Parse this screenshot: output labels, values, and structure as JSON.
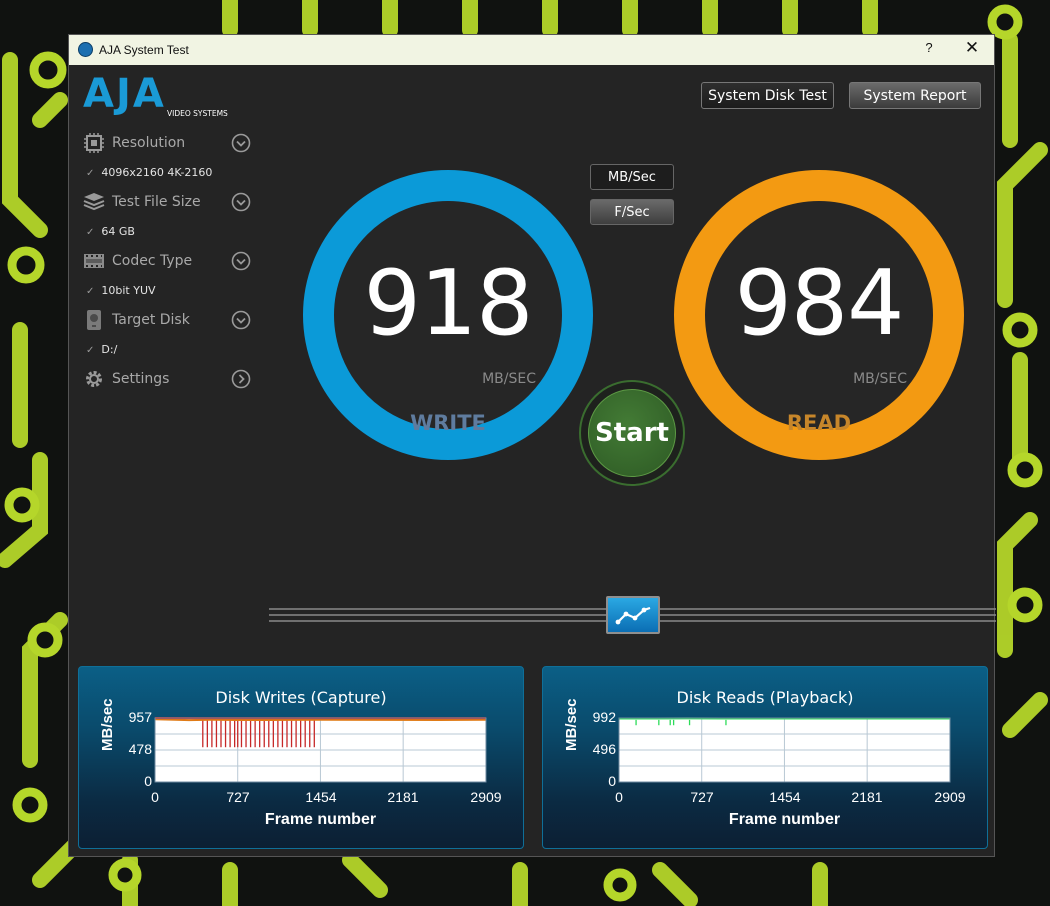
{
  "window": {
    "title": "AJA System Test",
    "help": "?",
    "close": "✕"
  },
  "logo": {
    "main": "AJA",
    "sub": "VIDEO SYSTEMS"
  },
  "toolbar": {
    "system_disk_test": "System Disk Test",
    "system_report": "System Report"
  },
  "sidebar": [
    {
      "label": "Resolution",
      "value": "4096x2160 4K-2160",
      "icon": "chip-icon"
    },
    {
      "label": "Test File Size",
      "value": "64 GB",
      "icon": "layers-icon"
    },
    {
      "label": "Codec Type",
      "value": "10bit YUV",
      "icon": "film-icon"
    },
    {
      "label": "Target Disk",
      "value": "D:/",
      "icon": "disk-icon"
    },
    {
      "label": "Settings",
      "value": "",
      "icon": "gear-icon"
    }
  ],
  "units": {
    "mb": "MB/Sec",
    "f": "F/Sec"
  },
  "write": {
    "value": "918",
    "unit": "MB/SEC",
    "label": "WRITE"
  },
  "read": {
    "value": "984",
    "unit": "MB/SEC",
    "label": "READ"
  },
  "start": "Start",
  "charts": {
    "writes": {
      "title": "Disk Writes (Capture)",
      "ylabel": "MB/sec",
      "xlabel": "Frame number",
      "yticks": [
        "957",
        "478",
        "0"
      ],
      "xticks": [
        "0",
        "727",
        "1454",
        "2181",
        "2909"
      ]
    },
    "reads": {
      "title": "Disk Reads (Playback)",
      "ylabel": "MB/sec",
      "xlabel": "Frame number",
      "yticks": [
        "992",
        "496",
        "0"
      ],
      "xticks": [
        "0",
        "727",
        "1454",
        "2181",
        "2909"
      ]
    }
  },
  "chart_data": [
    {
      "type": "line",
      "title": "Disk Writes (Capture)",
      "xlabel": "Frame number",
      "ylabel": "MB/sec",
      "xlim": [
        0,
        2909
      ],
      "ylim": [
        0,
        957
      ],
      "grid": true,
      "series": [
        {
          "values": [
            [
              0,
              938
            ],
            [
              300,
              925
            ],
            [
              500,
              930
            ],
            [
              727,
              928
            ],
            [
              1000,
              927
            ],
            [
              1454,
              930
            ],
            [
              2000,
              929
            ],
            [
              2500,
              928
            ],
            [
              2909,
              930
            ]
          ],
          "color": "#e07b16"
        },
        {
          "values": [
            [
              0,
              957
            ],
            [
              400,
              955
            ],
            [
              800,
              956
            ],
            [
              1200,
              955
            ],
            [
              1454,
              956
            ],
            [
              2000,
              955
            ],
            [
              2909,
              956
            ]
          ],
          "color": "#c62828"
        }
      ],
      "dips": [
        420,
        460,
        500,
        540,
        580,
        620,
        660,
        700,
        727,
        760,
        800,
        840,
        880,
        920,
        960,
        1000,
        1040,
        1080,
        1120,
        1160,
        1200,
        1240,
        1280,
        1320,
        1360,
        1400
      ],
      "dip_min": 520
    },
    {
      "type": "line",
      "title": "Disk Reads (Playback)",
      "xlabel": "Frame number",
      "ylabel": "MB/sec",
      "xlim": [
        0,
        2909
      ],
      "ylim": [
        0,
        992
      ],
      "grid": true,
      "series": [
        {
          "values": [
            [
              0,
              985
            ],
            [
              300,
              984
            ],
            [
              600,
              986
            ],
            [
              900,
              984
            ],
            [
              1454,
              985
            ],
            [
              2000,
              984
            ],
            [
              2500,
              985
            ],
            [
              2909,
              984
            ]
          ],
          "color": "#2ddc5a"
        }
      ],
      "dips": [
        150,
        350,
        450,
        480,
        620,
        940
      ],
      "dip_min": 880
    }
  ]
}
